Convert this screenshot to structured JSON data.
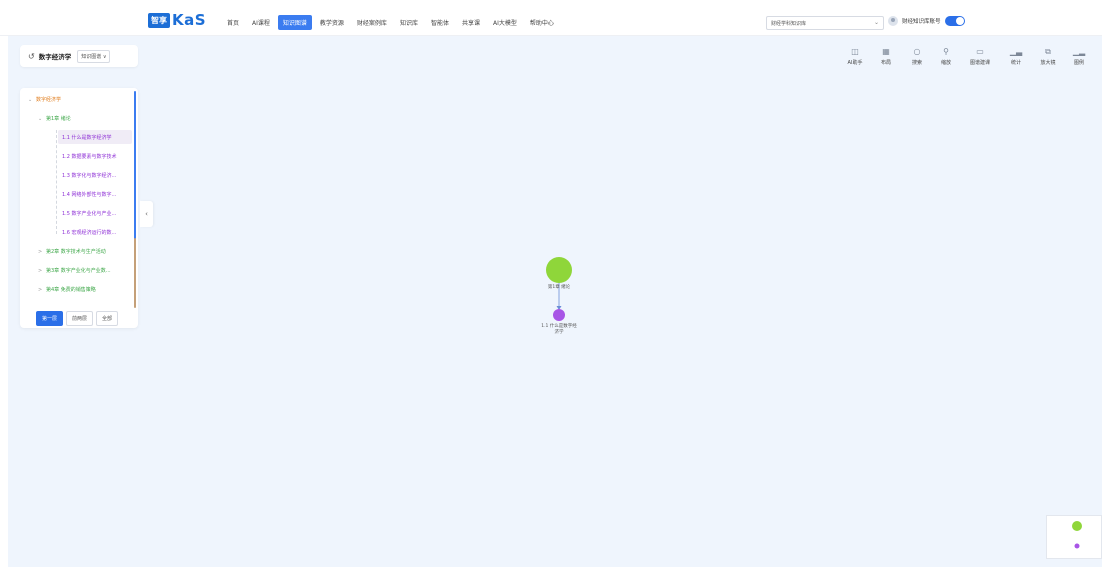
{
  "header": {
    "logo_box": "智享",
    "logo_text": "KaS",
    "nav": [
      {
        "label": "首页",
        "active": false
      },
      {
        "label": "AI课程",
        "active": false
      },
      {
        "label": "知识图谱",
        "active": true
      },
      {
        "label": "教学资源",
        "active": false
      },
      {
        "label": "财经案例库",
        "active": false
      },
      {
        "label": "知识库",
        "active": false
      },
      {
        "label": "智能体",
        "active": false
      },
      {
        "label": "共享课",
        "active": false
      },
      {
        "label": "AI大模型",
        "active": false
      },
      {
        "label": "帮助中心",
        "active": false
      }
    ],
    "knowledge_base_select": "财经学科知识库",
    "user_label": "财经知识库账号",
    "toggle_on": true
  },
  "course": {
    "title": "数字经济学",
    "mode": "知识图谱"
  },
  "tree": {
    "root": "数字经济学",
    "chapter1": "第1章 绪论",
    "sections": [
      "1.1 什么是数字经济学",
      "1.2 数据要素与数字技术",
      "1.3 数字化与数字经济...",
      "1.4 网络外部性与数字...",
      "1.5 数字产业化与产业...",
      "1.6 宏观经济运行的数..."
    ],
    "chapters_collapsed": [
      "第2章 数字技术与生产活动",
      "第3章 数字产业化与产业数...",
      "第4章 免费的销售策略"
    ],
    "level_buttons": [
      {
        "label": "第一层",
        "active": true
      },
      {
        "label": "前两层",
        "active": false
      },
      {
        "label": "全部",
        "active": false
      }
    ]
  },
  "toolbar": [
    {
      "label": "AI助手",
      "icon": "ai-assistant-icon"
    },
    {
      "label": "布局",
      "icon": "layout-icon"
    },
    {
      "label": "搜索",
      "icon": "search-icon"
    },
    {
      "label": "缩放",
      "icon": "zoom-icon"
    },
    {
      "label": "图谱建课",
      "icon": "build-course-icon"
    },
    {
      "label": "统计",
      "icon": "statistics-icon"
    },
    {
      "label": "放大镜",
      "icon": "magnifier-icon"
    },
    {
      "label": "图例",
      "icon": "legend-icon"
    }
  ],
  "graph": {
    "node_chapter": "第1章 绪论",
    "node_section_line1": "1.1 什么是数字经",
    "node_section_line2": "济学",
    "colors": {
      "chapter": "#8fd63a",
      "section": "#a855e6",
      "accent": "#2b6fe8"
    }
  }
}
